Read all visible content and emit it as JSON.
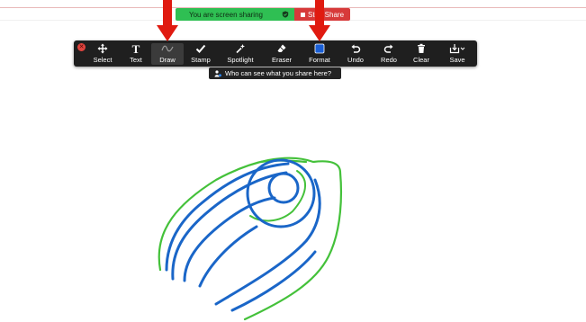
{
  "banner": {
    "status_text": "You are screen sharing",
    "stop_label": "Stop Share",
    "status_color": "#2fbf53",
    "stop_color": "#d73a3a"
  },
  "toolbar": {
    "tools": [
      {
        "label": "Select",
        "icon": "move-arrows-icon"
      },
      {
        "label": "Text",
        "icon": "text-t-icon"
      },
      {
        "label": "Draw",
        "icon": "draw-squiggle-icon",
        "active": true
      },
      {
        "label": "Stamp",
        "icon": "checkmark-stamp-icon"
      },
      {
        "label": "Spotlight",
        "icon": "spotlight-wand-icon"
      },
      {
        "label": "Eraser",
        "icon": "eraser-icon"
      },
      {
        "label": "Format",
        "icon": "format-color-swatch-icon"
      },
      {
        "label": "Undo",
        "icon": "undo-icon"
      },
      {
        "label": "Redo",
        "icon": "redo-icon"
      },
      {
        "label": "Clear",
        "icon": "trash-icon"
      },
      {
        "label": "Save",
        "icon": "save-download-icon"
      }
    ],
    "format_color": "#1a5fd6"
  },
  "tooltip": {
    "text": "Who can see what you share here?"
  },
  "annotations": {
    "arrow_color": "#e01a10",
    "pen_blue": "#1a66c8",
    "pen_green": "#44c13a"
  }
}
